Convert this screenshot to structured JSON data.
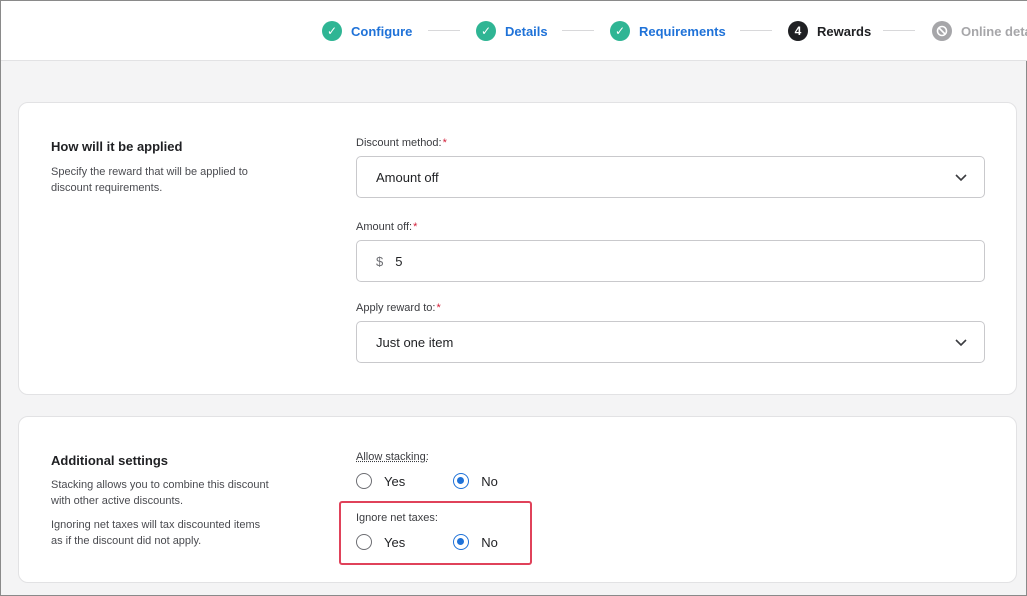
{
  "stepper": {
    "steps": [
      {
        "label": "Configure",
        "state": "done",
        "marker": "✓"
      },
      {
        "label": "Details",
        "state": "done",
        "marker": "✓"
      },
      {
        "label": "Requirements",
        "state": "done",
        "marker": "✓"
      },
      {
        "label": "Rewards",
        "state": "current",
        "marker": "4"
      },
      {
        "label": "Online deta",
        "state": "disabled",
        "marker": "⊘"
      }
    ]
  },
  "applied": {
    "title": "How will it be applied",
    "description": "Specify the reward that will be applied to discount requirements.",
    "discount_method": {
      "label": "Discount method:",
      "required_mark": "*",
      "value": "Amount off"
    },
    "amount_off": {
      "label": "Amount off:",
      "required_mark": "*",
      "prefix": "$",
      "value": "5"
    },
    "apply_reward_to": {
      "label": "Apply reward to:",
      "required_mark": "*",
      "value": "Just one item"
    }
  },
  "additional": {
    "title": "Additional settings",
    "description_1": "Stacking allows you to combine this discount with other active discounts.",
    "description_2": "Ignoring net taxes will tax discounted items as if the discount did not apply.",
    "allow_stacking": {
      "label": "Allow stacking:",
      "yes": "Yes",
      "no": "No",
      "selected": "No"
    },
    "ignore_net_taxes": {
      "label": "Ignore net taxes:",
      "yes": "Yes",
      "no": "No",
      "selected": "No"
    }
  },
  "colors": {
    "accent": "#1f72d8",
    "done": "#2fb594",
    "required": "#d3203a",
    "highlight": "#e0425a"
  },
  "icons": {
    "done_step": "check-circle-icon",
    "disabled_step": "disabled-circle-icon",
    "select": "chevron-down-icon"
  }
}
